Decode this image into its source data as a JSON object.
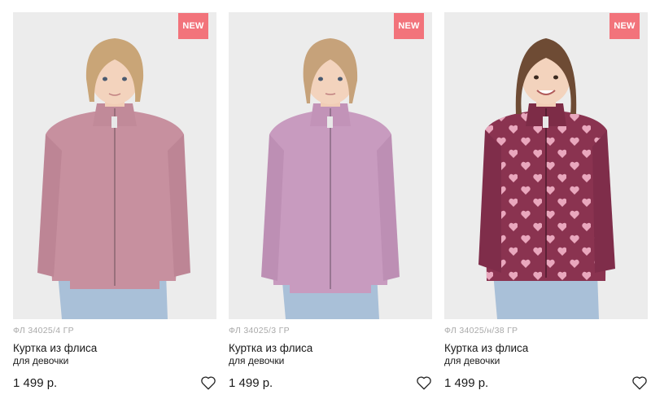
{
  "products": [
    {
      "badge": "NEW",
      "sku": "ФЛ 34025/4 ГР",
      "name": "Куртка из флиса",
      "subtitle": "для девочки",
      "price": "1 499 р.",
      "jacket_color": "#c7909f",
      "hair_color": "#c9a577"
    },
    {
      "badge": "NEW",
      "sku": "ФЛ 34025/3 ГР",
      "name": "Куртка из флиса",
      "subtitle": "для девочки",
      "price": "1 499 р.",
      "jacket_color": "#c89bbf",
      "hair_color": "#c6a27a"
    },
    {
      "badge": "NEW",
      "sku": "ФЛ 34025/н/38 ГР",
      "name": "Куртка из флиса",
      "subtitle": "для девочки",
      "price": "1 499 р.",
      "jacket_color": "#8a3350",
      "hair_color": "#6e4b34"
    }
  ],
  "icons": {
    "favorite": "heart-outline-icon"
  }
}
